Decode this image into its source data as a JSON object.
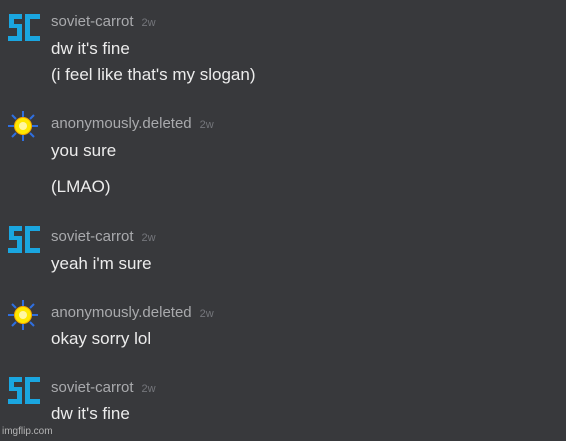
{
  "colors": {
    "background": "#38393c",
    "username": "#a9aaad",
    "timestamp": "#74767b",
    "message_text": "#ececec",
    "sc_avatar_blue": "#1aa6e0",
    "sun_avatar_yellow": "#ffe800",
    "sun_avatar_blue": "#2f6fe0"
  },
  "messages": [
    {
      "avatar_icon": "sc-logo-icon",
      "username": "soviet-carrot",
      "timestamp": "2w",
      "lines": [
        "dw it's fine",
        "(i feel like that's my slogan)"
      ]
    },
    {
      "avatar_icon": "sun-icon",
      "username": "anonymously.deleted",
      "timestamp": "2w",
      "lines": [
        "you sure",
        "(LMAO)"
      ]
    },
    {
      "avatar_icon": "sc-logo-icon",
      "username": "soviet-carrot",
      "timestamp": "2w",
      "lines": [
        "yeah i'm sure"
      ]
    },
    {
      "avatar_icon": "sun-icon",
      "username": "anonymously.deleted",
      "timestamp": "2w",
      "lines": [
        "okay sorry lol"
      ]
    },
    {
      "avatar_icon": "sc-logo-icon",
      "username": "soviet-carrot",
      "timestamp": "2w",
      "lines": [
        "dw it's fine"
      ]
    }
  ],
  "watermark": "imgflip.com"
}
